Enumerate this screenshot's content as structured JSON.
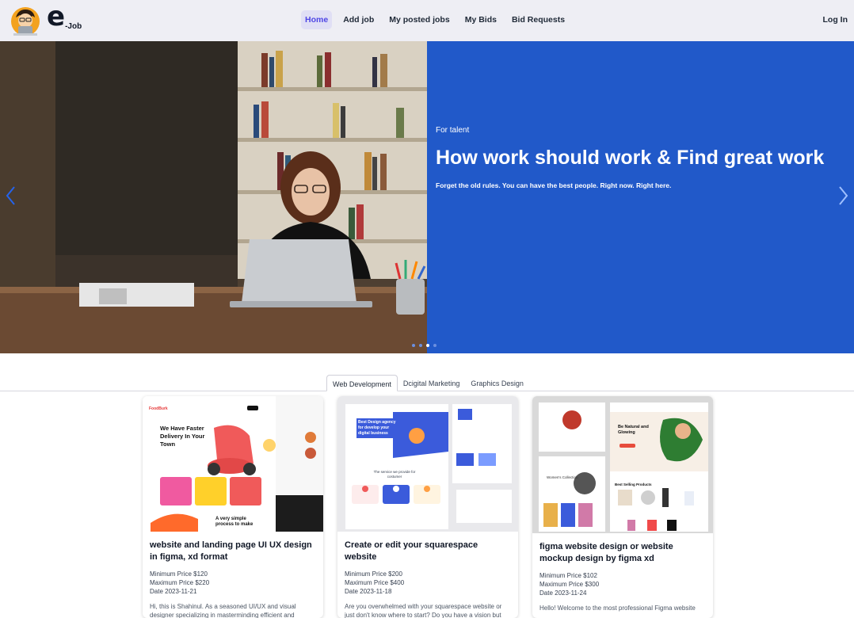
{
  "brand": {
    "letter": "e",
    "suffix": "-Job"
  },
  "nav": {
    "items": [
      {
        "label": "Home",
        "active": true
      },
      {
        "label": "Add job",
        "active": false
      },
      {
        "label": "My posted jobs",
        "active": false
      },
      {
        "label": "My Bids",
        "active": false
      },
      {
        "label": "Bid Requests",
        "active": false
      }
    ],
    "login_label": "Log In"
  },
  "hero": {
    "kicker": "For talent",
    "title": "How work should work & Find great work",
    "subtitle": "Forget the old rules. You can have the best people. Right now. Right here.",
    "accent_color": "#2159c9",
    "slide_count": 4,
    "active_slide": 3
  },
  "tabs": [
    {
      "label": "Web Development",
      "active": true
    },
    {
      "label": "Dcigital Marketing",
      "active": false
    },
    {
      "label": "Graphics Design",
      "active": false
    }
  ],
  "cards": [
    {
      "title": "website and landing page UI UX design in figma, xd format",
      "min_price": "Minimum Price $120",
      "max_price": "Maximum Price $220",
      "date": "Date 2023-11-21",
      "description": "Hi, this is Shahinul. As a seasoned UI/UX and visual designer specializing in masterminding efficient and",
      "thumb": {
        "logo": "FoodBurk",
        "headline": "We Have Faster Delivery In Your Town",
        "tagline": "A very simple process to make"
      }
    },
    {
      "title": "Create or edit your squarespace website",
      "min_price": "Minimum Price $200",
      "max_price": "Maximum Price $400",
      "date": "Date 2023-11-18",
      "description": "Are you overwhelmed with your squarespace website or just don't know where to start? Do you have a vision but can't put it on the screen? I can help! Whether your site needs a",
      "thumb": {
        "headline": "Best Design agency for develop your digital business",
        "tagline": "The service we provide for costumer"
      }
    },
    {
      "title": "figma website design or website mockup design by figma xd",
      "min_price": "Minimum Price $102",
      "max_price": "Maximum Price $300",
      "date": "Date 2023-11-24",
      "description": "Hello! Welcome to the most professional Figma website",
      "thumb": {
        "headline": "Be Natural and Glowing",
        "section": "Best Selling Products",
        "collection": "Women's Collection"
      }
    }
  ]
}
